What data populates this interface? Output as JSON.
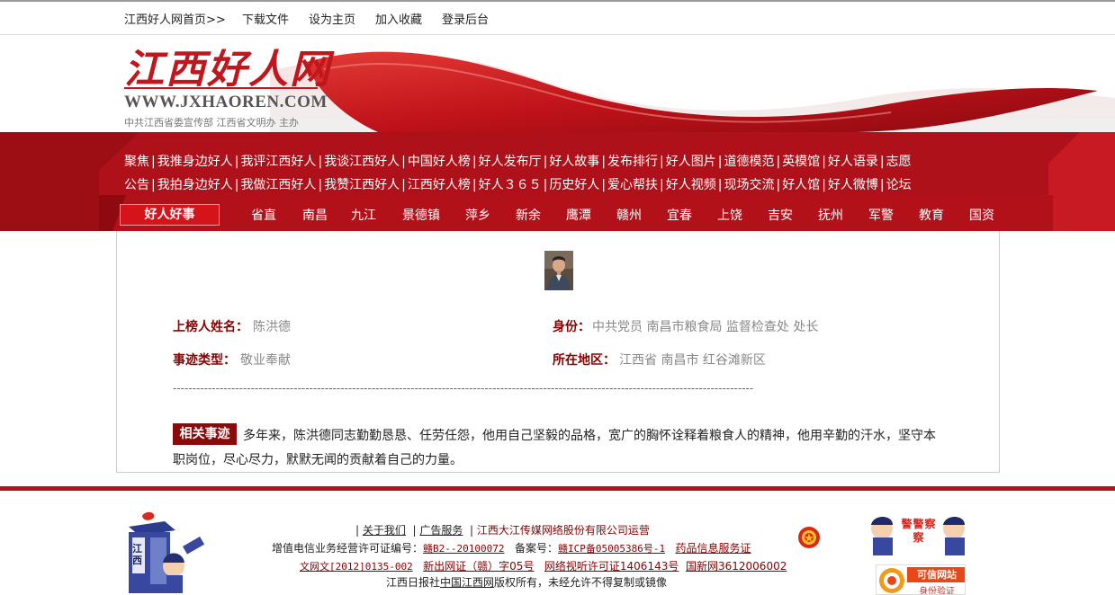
{
  "topbar": {
    "home": "江西好人网首页>>",
    "download": "下载文件",
    "set_home": "设为主页",
    "favorite": "加入收藏",
    "login": "登录后台"
  },
  "header": {
    "logo_text": "江西好人网",
    "logo_url": "WWW.JXHAOREN.COM",
    "sponsor": "中共江西省委宣传部 江西省文明办 主办"
  },
  "nav": {
    "row1": [
      "聚焦",
      "我推身边好人",
      "我评江西好人",
      "我谈江西好人",
      "中国好人榜",
      "好人发布厅",
      "好人故事",
      "发布排行",
      "好人图片",
      "道德模范",
      "英模馆",
      "好人语录",
      "志愿"
    ],
    "row2": [
      "公告",
      "我拍身边好人",
      "我做江西好人",
      "我赞江西好人",
      "江西好人榜",
      "好人３６５",
      "历史好人",
      "爱心帮扶",
      "好人视频",
      "现场交流",
      "好人馆",
      "好人微博",
      "论坛"
    ],
    "region_title": "好人好事",
    "regions": [
      "省直",
      "南昌",
      "九江",
      "景德镇",
      "萍乡",
      "新余",
      "鹰潭",
      "赣州",
      "宜春",
      "上饶",
      "吉安",
      "抚州",
      "军警",
      "教育",
      "国资"
    ]
  },
  "profile": {
    "name_label": "上榜人姓名：",
    "name": "陈洪德",
    "identity_label": "身份：",
    "identity": "中共党员  南昌市粮食局  监督检查处  处长",
    "type_label": "事迹类型：",
    "type": "敬业奉献",
    "region_label": "所在地区：",
    "region": "江西省  南昌市  红谷滩新区",
    "dashes": "-----------------------------------------------------------------------------------------------------------------------------------------------------",
    "story_tag": "相关事迹",
    "story": "多年来，陈洪德同志勤勤恳恳、任劳任怨，他用自己坚毅的品格，宽广的胸怀诠释着粮食人的精神，他用辛勤的汗水，坚守本职岗位，尽心尽力，默默无闻的贡献着自己的力量。"
  },
  "footer": {
    "about": "关于我们",
    "ads": "广告服务",
    "operator": "江西大江传媒网络股份有限公司运营",
    "license_prefix": "增值电信业务经营许可证编号：",
    "license_no": "赣B2--20100072",
    "record_prefix": "备案号：",
    "record_no": "赣ICP备05005386号-1",
    "drug_info": "药品信息服务证",
    "culture_license": "文网文[2012]0135-002",
    "news_license": "新出网证（赣）字05号",
    "av_license": "网络视听许可证1406143号",
    "gov_license": "国新网3612006002",
    "copyright_prefix": "江西日报社",
    "copyright_site": "中国江西网",
    "copyright_suffix": "版权所有，未经允许不得复制或镜像",
    "police_box_label": "江西",
    "police_label": "警警察察",
    "trust_label": "可信网站",
    "trust_sub": "身份验证"
  }
}
